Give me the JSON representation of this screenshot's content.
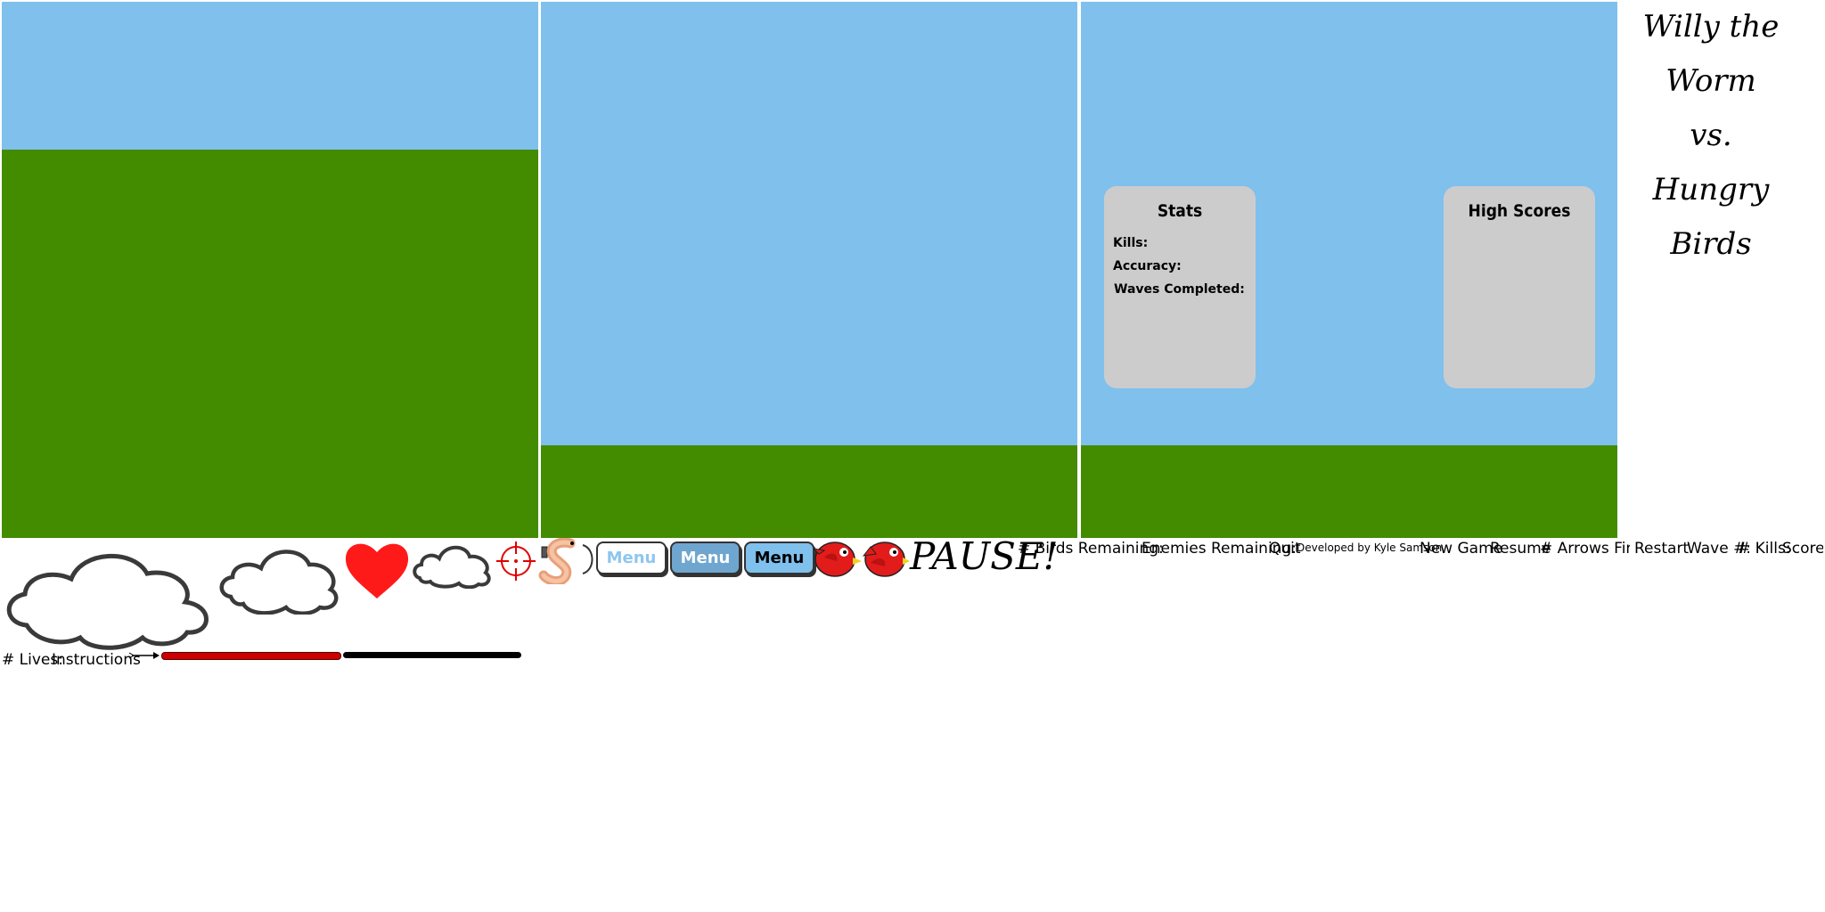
{
  "title": {
    "line1": "Willy the Worm",
    "line2": "vs.",
    "line3": "Hungry Birds"
  },
  "stats_panel": {
    "title": "Stats",
    "kills_label": "Kills:",
    "accuracy_label": "Accuracy:",
    "waves_label": "Waves Completed:"
  },
  "highscores_panel": {
    "title": "High Scores"
  },
  "buttons": {
    "menu_light": "Menu",
    "menu_pressed": "Menu",
    "menu_normal": "Menu"
  },
  "pause_text": "PAUSE!",
  "labels": {
    "birds_remaining": "# Birds Remaining:",
    "enemies_remaining": "Enemies Remaining:",
    "quit": "Quit",
    "developed_by": "Developed by Kyle Samson",
    "new_game": "New Game",
    "resume": "Resume",
    "arrows_fired": "# Arrows Fired",
    "restart": "Restart",
    "wave": "Wave #:",
    "kills": "# Kills:",
    "score": "Score:",
    "lives": "# Lives:",
    "instructions": "Instructions"
  },
  "colors": {
    "sky": "#7fc0ed",
    "grass": "#438c00",
    "panel": "#cccccc",
    "heart": "#ff1a1a",
    "bird": "#e21b1b",
    "health_bar": "#cc0000",
    "empty_bar": "#000000"
  },
  "icons": [
    "cloud-large-icon",
    "cloud-medium-icon",
    "heart-icon",
    "cloud-small-icon",
    "crosshair-icon",
    "worm-icon",
    "bow-icon",
    "bird-icon",
    "bird-flap-icon",
    "arrow-icon"
  ]
}
